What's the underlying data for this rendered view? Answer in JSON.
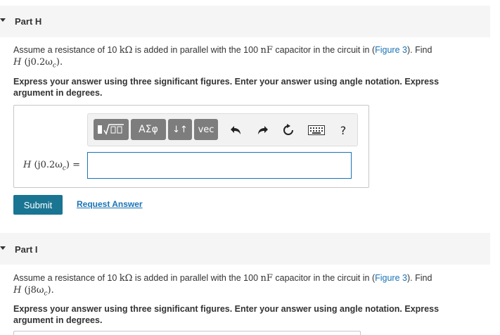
{
  "part_h": {
    "title": "Part H",
    "problem": {
      "prefix": "Assume a resistance of 10 ",
      "unit_res": "kΩ",
      "middle": " is added in parallel with the 100 ",
      "unit_cap": "nF",
      "middle2": " capacitor in the circuit in (",
      "figure_link": "Figure 3",
      "suffix": "). Find",
      "expr_fn": "H",
      "expr_arg": " (j0.2ω",
      "expr_sub": "c",
      "expr_close": ").",
      "expr_tail": ""
    },
    "instructions": "Express your answer using three significant figures. Enter your answer using angle notation. Express argument in degrees.",
    "toolbar": {
      "templates_label": "▯√▯",
      "greek_label": "ΑΣφ",
      "arrows_label": "↓↑",
      "vec_label": "vec",
      "help_label": "?"
    },
    "answer": {
      "label_fn": "H",
      "label_arg": " (j0.2ω",
      "label_sub": "c",
      "label_close": ") =",
      "value": ""
    },
    "submit_label": "Submit",
    "request_label": "Request Answer"
  },
  "part_i": {
    "title": "Part I",
    "problem": {
      "prefix": "Assume a resistance of 10 ",
      "unit_res": "kΩ",
      "middle": " is added in parallel with the 100 ",
      "unit_cap": "nF",
      "middle2": " capacitor in the circuit in (",
      "figure_link": "Figure 3",
      "suffix": "). Find",
      "expr_fn": "H",
      "expr_arg": " (j8ω",
      "expr_sub": "c",
      "expr_close": ")."
    },
    "instructions": "Express your answer using three significant figures. Enter your answer using angle notation. Express argument in degrees."
  },
  "colors": {
    "link": "#1a73b5",
    "submit_bg": "#1a7593",
    "header_bg": "#f5f5f5",
    "toolbar_btn": "#7d7d7d"
  }
}
